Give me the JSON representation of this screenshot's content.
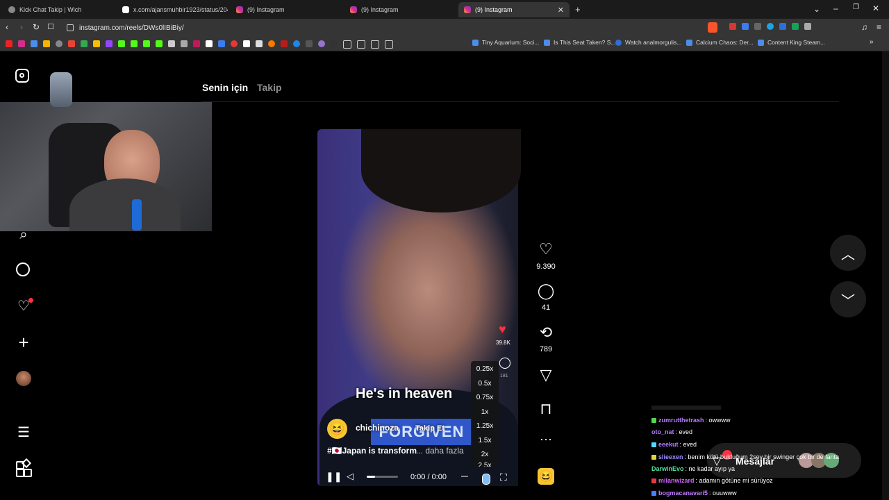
{
  "browser": {
    "tabs": [
      {
        "title": "Kick Chat Takip | Wich",
        "active": false
      },
      {
        "title": "x.com/ajansmuhbir1923/status/2043...",
        "active": false
      },
      {
        "title": "(9) Instagram",
        "active": false
      },
      {
        "title": "(9) Instagram",
        "active": false
      },
      {
        "title": "(9) Instagram",
        "active": true
      }
    ],
    "new_tab_label": "+",
    "url": "instagram.com/reels/DWs0lIBiBiy/",
    "bookmarks": [
      {
        "label": "Tiny Aquarium: Soci..."
      },
      {
        "label": "Is This Seat Taken? S..."
      },
      {
        "label": "Watch analmorgulis..."
      },
      {
        "label": "Calcium Chaos: Der..."
      },
      {
        "label": "Content King Steam..."
      }
    ]
  },
  "instagram": {
    "feed_tabs": {
      "for_you": "Senin için",
      "following": "Takip"
    },
    "video": {
      "caption_overlay": "He's in heaven",
      "banner_text": "FORGIVEN",
      "username": "chichinoza",
      "follow_label": "Takip Et",
      "description": "#🇯🇵Japan is transform",
      "more_label": "... daha fazla",
      "time": "0:00 / 0:00",
      "inner_like_count": "39.8K",
      "inner_comment_count": "181",
      "speed_options": [
        "0.25x",
        "0.5x",
        "0.75x",
        "1x",
        "1.25x",
        "1.5x",
        "2x",
        "2.5x"
      ]
    },
    "actions": {
      "likes": "9.390",
      "comments": "41",
      "reposts": "789"
    },
    "messages_label": "Mesajlar"
  },
  "chat": {
    "lines": [
      {
        "user": "zumrutthetrash",
        "text": ": owwww",
        "color": "#b57cff",
        "badge": "#4fd84f"
      },
      {
        "user": "oto_nat",
        "text": ": eved",
        "color": "#b57cff",
        "badge": ""
      },
      {
        "user": "eeekut",
        "text": ": eved",
        "color": "#b57cff",
        "badge": "#4fd8ff"
      },
      {
        "user": "slieexen",
        "text": ": benim kötü bulduğum 2sey bir swinger çok bir de fanta",
        "color": "#9b8cff",
        "badge": "#e6d23a"
      },
      {
        "user": "DarwinEvo",
        "text": ": ne kadar ayıp ya",
        "color": "#4fe3a0",
        "badge": ""
      },
      {
        "user": "milanwizard",
        "text": ": adamın götüne mi sürüyoz",
        "color": "#d264ff",
        "badge": "#e33b3b"
      },
      {
        "user": "bogmacanavari5",
        "text": ": ouuwww",
        "color": "#c07cff",
        "badge": "#4f7bff"
      }
    ]
  },
  "colors": {
    "like_red": "#ff3040",
    "ig_black": "#000000",
    "chrome_bg": "#353535"
  }
}
